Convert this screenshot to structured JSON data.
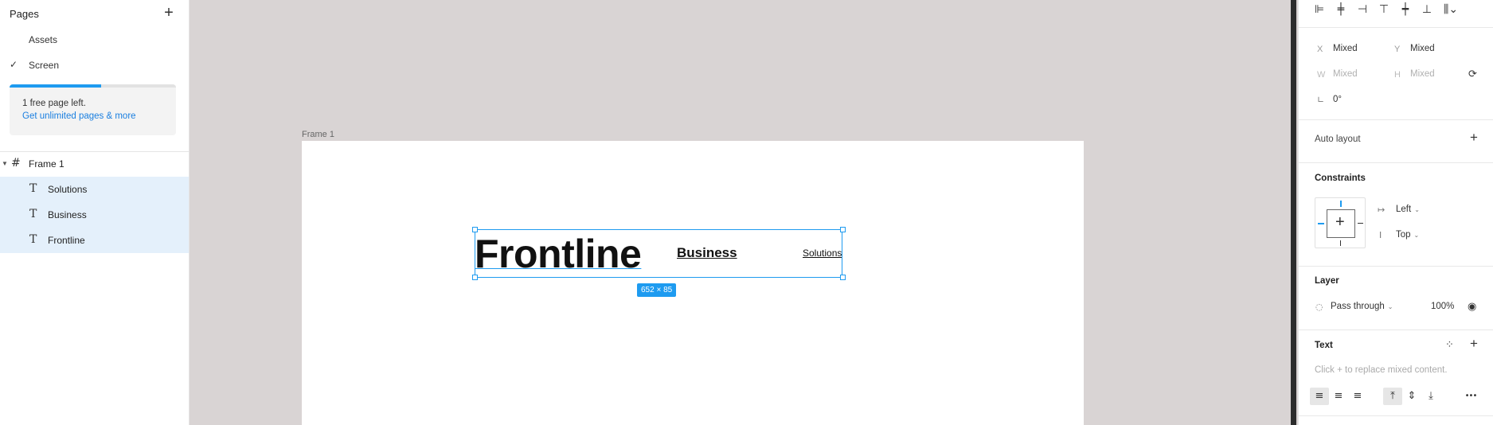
{
  "pages": {
    "header": "Pages",
    "add_icon": "+",
    "items": [
      {
        "label": "Assets",
        "selected": false
      },
      {
        "label": "Screen",
        "selected": true
      }
    ],
    "check_glyph": "✓",
    "promo": {
      "line1": "1 free page left.",
      "link": "Get unlimited pages & more",
      "progress_fraction": 0.55
    }
  },
  "layers": [
    {
      "name": "Frame 1",
      "type": "frame",
      "glyph": "#"
    },
    {
      "name": "Solutions",
      "type": "text",
      "glyph": "T"
    },
    {
      "name": "Business",
      "type": "text",
      "glyph": "T"
    },
    {
      "name": "Frontline",
      "type": "text",
      "glyph": "T"
    }
  ],
  "canvas": {
    "frame_label": "Frame 1",
    "texts": {
      "frontline": "Frontline",
      "business": "Business",
      "solutions": "Solutions"
    },
    "dimension_badge": "652 × 85"
  },
  "properties": {
    "x_label": "X",
    "x_value": "Mixed",
    "y_label": "Y",
    "y_value": "Mixed",
    "w_label": "W",
    "w_value": "Mixed",
    "h_label": "H",
    "h_value": "Mixed",
    "rotation_icon": "∟",
    "rotation": "0°",
    "auto_layout": "Auto layout",
    "constraints_title": "Constraints",
    "constraint_h": "Left",
    "constraint_v": "Top",
    "layer_title": "Layer",
    "blend_mode": "Pass through",
    "opacity": "100%",
    "text_title": "Text",
    "text_hint": "Click + to replace mixed content."
  },
  "glyphs": {
    "plus": "+",
    "chevron": "⌄",
    "eye": "◉",
    "more": "•••",
    "styles": "⁘",
    "opacity_drop": "◌"
  },
  "colors": {
    "accent": "#1e9bf0",
    "canvas_bg": "#d9d4d4",
    "selection_bg": "#e4f0fb"
  }
}
